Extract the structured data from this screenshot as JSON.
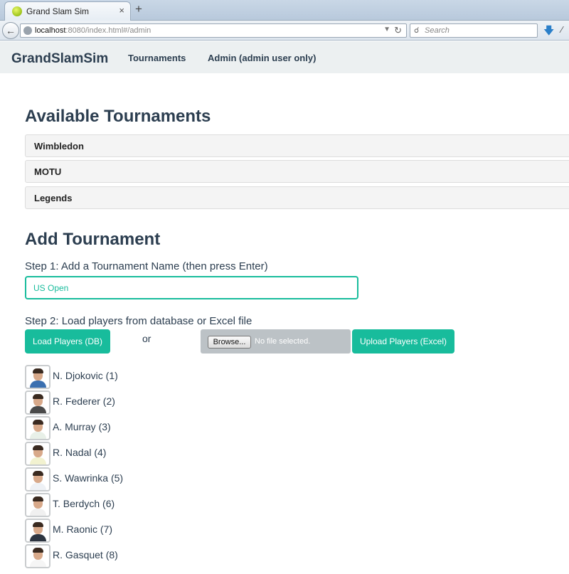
{
  "browser": {
    "tab_title": "Grand Slam Sim",
    "tab_close": "×",
    "new_tab": "+",
    "url_host": "localhost",
    "url_rest": ":8080/index.html#/admin",
    "search_placeholder": "Search"
  },
  "nav": {
    "brand": "GrandSlamSim",
    "links": [
      "Tournaments",
      "Admin (admin user only)"
    ]
  },
  "available": {
    "heading": "Available Tournaments",
    "tournaments": [
      "Wimbledon",
      "MOTU",
      "Legends"
    ]
  },
  "add": {
    "heading": "Add Tournament",
    "step1": "Step 1: Add a Tournament Name (then press Enter)",
    "name_value": "US Open",
    "step2": "Step 2: Load players from database or Excel file",
    "load_db_button": "Load Players (DB)",
    "or": "or",
    "browse_button": "Browse...",
    "file_status": "No file selected.",
    "upload_button": "Upload Players (Excel)"
  },
  "players": [
    {
      "name": "N. Djokovic (1)",
      "shirt": "#3a6fb0"
    },
    {
      "name": "R. Federer (2)",
      "shirt": "#4a4a4a"
    },
    {
      "name": "A. Murray (3)",
      "shirt": "#e8f0e8"
    },
    {
      "name": "R. Nadal (4)",
      "shirt": "#f2f2d0"
    },
    {
      "name": "S. Wawrinka (5)",
      "shirt": "#eef1f5"
    },
    {
      "name": "T. Berdych (6)",
      "shirt": "#f0f0f0"
    },
    {
      "name": "M. Raonic (7)",
      "shirt": "#2c3440"
    },
    {
      "name": "R. Gasquet (8)",
      "shirt": "#f5f5f5"
    }
  ],
  "colors": {
    "accent": "#18bc9c",
    "text": "#2c3e50",
    "navbar_bg": "#ecf0f1"
  }
}
